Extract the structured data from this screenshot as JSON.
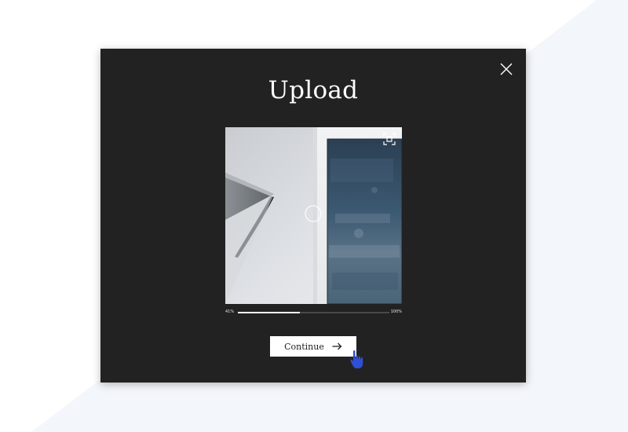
{
  "modal": {
    "title": "Upload",
    "close_icon": "close-icon"
  },
  "preview": {
    "crop_icon": "crop-icon",
    "loading_icon": "loading-spinner-icon"
  },
  "upload": {
    "progress": 0.41,
    "start_label": "41%",
    "end_label": "100%"
  },
  "actions": {
    "continue_label": "Continue",
    "continue_icon": "arrow-right-icon"
  },
  "cursor": {
    "icon": "hand-pointer-icon",
    "color": "#2f4fd6"
  },
  "colors": {
    "modal_bg": "#222222",
    "page_bg": "#ffffff",
    "accent_shape": "#f4f7fb"
  }
}
